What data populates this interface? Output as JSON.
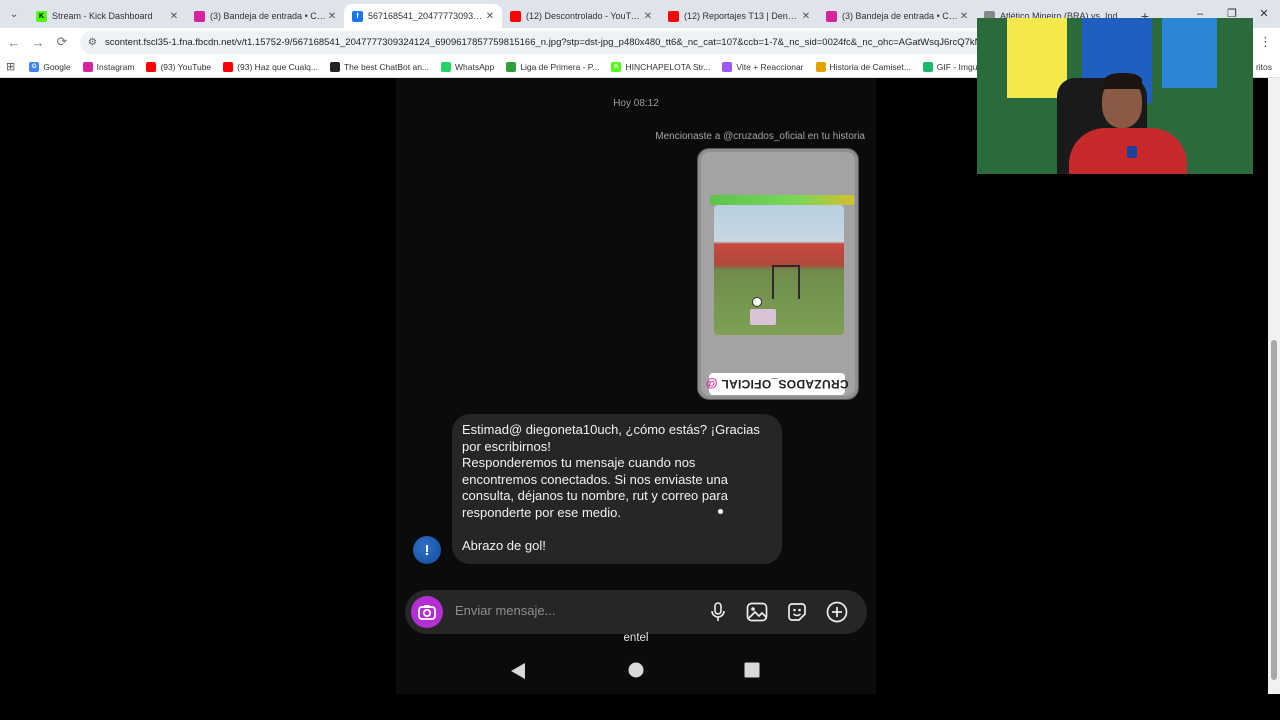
{
  "browser": {
    "tabs": [
      {
        "title": "Stream - Kick Dashboard",
        "fav": "K",
        "color": "#53fc18",
        "fg": "#000",
        "active": false
      },
      {
        "title": "(3) Bandeja de entrada • Chats",
        "fav": "",
        "color": "#d6249f",
        "fg": "#fff",
        "active": false
      },
      {
        "title": "567168541_204777730932412...",
        "fav": "f",
        "color": "#1877f2",
        "fg": "#fff",
        "active": true
      },
      {
        "title": "(12) Descontrolado - YouTube",
        "fav": "",
        "color": "#ff0000",
        "fg": "#fff",
        "active": false
      },
      {
        "title": "(12) Reportajes T13 | Denuncia...",
        "fav": "",
        "color": "#ff0000",
        "fg": "#fff",
        "active": false
      },
      {
        "title": "(3) Bandeja de entrada • Chats",
        "fav": "",
        "color": "#d6249f",
        "fg": "#fff",
        "active": false
      },
      {
        "title": "Atlético Mineiro (BRA) vs. Inde...",
        "fav": "",
        "color": "#888888",
        "fg": "#fff",
        "active": false
      }
    ],
    "address": "scontent.fscl35-1.fna.fbcdn.net/v/t1.15752-9/567168541_2047777309324124_6909617857759815166_n.jpg?stp=dst-jpg_p480x480_tt6&_nc_cat=107&ccb=1-7&_nc_sid=0024fc&_nc_ohc=AGatWsqJ6rcQ7kNvwGBt",
    "bookmarks": [
      {
        "label": "Google",
        "icon": "google-icon",
        "color": "#4285f4",
        "glyph": "G"
      },
      {
        "label": "Instagram",
        "icon": "instagram-icon",
        "color": "#d6249f",
        "glyph": ""
      },
      {
        "label": "(93) YouTube",
        "icon": "youtube-icon",
        "color": "#ff0000",
        "glyph": ""
      },
      {
        "label": "(93) Haz que Cualq...",
        "icon": "youtube-icon",
        "color": "#ff0000",
        "glyph": ""
      },
      {
        "label": "The best ChatBot an...",
        "icon": "openai-icon",
        "color": "#222222",
        "glyph": ""
      },
      {
        "label": "WhatsApp",
        "icon": "whatsapp-icon",
        "color": "#25d366",
        "glyph": ""
      },
      {
        "label": "Liga de Primera - P...",
        "icon": "league-icon",
        "color": "#2e9d3a",
        "glyph": ""
      },
      {
        "label": "HINCHAPELOTA Str...",
        "icon": "kick-icon",
        "color": "#53fc18",
        "glyph": "K"
      },
      {
        "label": "Vite + Reaccionar",
        "icon": "vite-icon",
        "color": "#9b59f6",
        "glyph": ""
      },
      {
        "label": "Historia de Camiset...",
        "icon": "shirt-icon",
        "color": "#e5a100",
        "glyph": ""
      },
      {
        "label": "GIF - Imgur",
        "icon": "imgur-icon",
        "color": "#1bb76e",
        "glyph": ""
      }
    ],
    "bookmarks_all": "ritos"
  },
  "chat": {
    "timestamp": "Hoy 08:12",
    "mention_note": "Mencionaste a @cruzados_oficial en tu historia",
    "story_tag": "CRUZADOS_OFICIAL",
    "message_lines": [
      "Estimad@ diegoneta10uch, ¿cómo estás? ¡Gracias",
      "por escribirnos!",
      "Responderemos tu mensaje cuando nos",
      "encontremos conectados. Si nos enviaste una",
      "consulta, déjanos tu nombre, rut y correo para",
      "responderte por ese medio."
    ],
    "message_sign": "Abrazo de gol!",
    "composer_placeholder": "Enviar mensaje...",
    "carrier": "entel"
  }
}
